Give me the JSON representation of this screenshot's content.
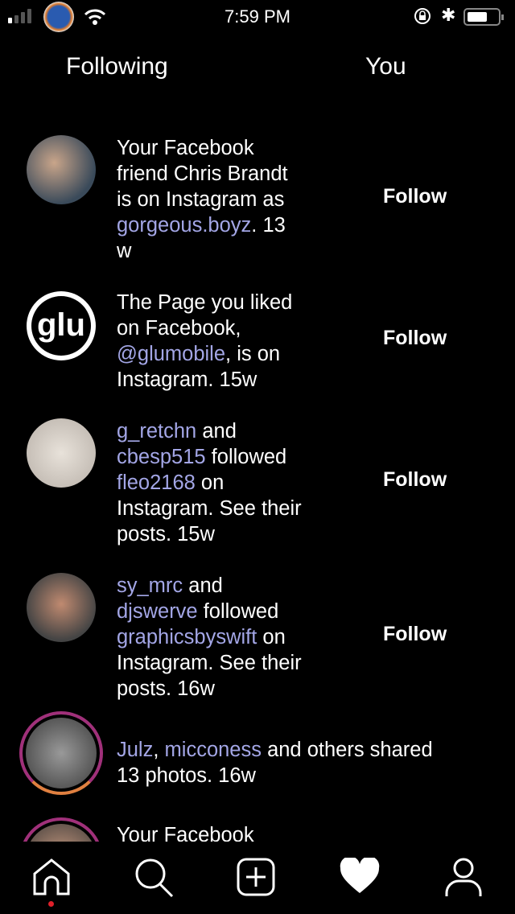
{
  "status_bar": {
    "time": "7:59 PM"
  },
  "tabs": [
    {
      "label": "Following"
    },
    {
      "label": "You"
    }
  ],
  "feed": [
    {
      "lines": [
        [
          {
            "t": "Your Facebook"
          }
        ],
        [
          {
            "t": "friend Chris Brandt"
          }
        ],
        [
          {
            "t": "is on Instagram as"
          }
        ],
        [
          {
            "t": "gorgeous.boyz",
            "link": true
          },
          {
            "t": ". 13"
          }
        ],
        [
          {
            "t": "w"
          }
        ]
      ],
      "follow": "Follow"
    },
    {
      "lines": [
        [
          {
            "t": "The Page you liked"
          }
        ],
        [
          {
            "t": "on Facebook,"
          }
        ],
        [
          {
            "t": "@glumobile",
            "link": true
          },
          {
            "t": ", is on"
          }
        ],
        [
          {
            "t": "Instagram. 15w"
          }
        ]
      ],
      "follow": "Follow",
      "avatar_text": "glu"
    },
    {
      "lines": [
        [
          {
            "t": "g_retchn",
            "link": true
          },
          {
            "t": " and"
          }
        ],
        [
          {
            "t": "cbesp515",
            "link": true
          },
          {
            "t": " followed"
          }
        ],
        [
          {
            "t": "fleo2168",
            "link": true
          },
          {
            "t": " on"
          }
        ],
        [
          {
            "t": "Instagram. See their"
          }
        ],
        [
          {
            "t": "posts. 15w"
          }
        ]
      ],
      "follow": "Follow"
    },
    {
      "lines": [
        [
          {
            "t": "sy_mrc",
            "link": true
          },
          {
            "t": " and"
          }
        ],
        [
          {
            "t": "djswerve",
            "link": true
          },
          {
            "t": " followed"
          }
        ],
        [
          {
            "t": "graphicsbyswift",
            "link": true
          },
          {
            "t": " on"
          }
        ],
        [
          {
            "t": "Instagram. See their"
          }
        ],
        [
          {
            "t": "posts. 16w"
          }
        ]
      ],
      "follow": "Follow"
    },
    {
      "lines": [
        [
          {
            "t": "Julz",
            "link": true
          },
          {
            "t": ", "
          },
          {
            "t": "micconess",
            "link": true
          },
          {
            "t": " and others shared"
          }
        ],
        [
          {
            "t": "13 photos. 16w"
          }
        ]
      ],
      "story_ring": true
    },
    {
      "lines": [
        [
          {
            "t": "Your Facebook"
          }
        ]
      ],
      "story_ring": true
    }
  ],
  "nav": [
    {
      "icon": "home-icon",
      "active": true
    },
    {
      "icon": "search-icon"
    },
    {
      "icon": "add-post-icon"
    },
    {
      "icon": "heart-icon"
    },
    {
      "icon": "profile-icon"
    }
  ],
  "colors": {
    "link": "#a3a6e6",
    "notification_dot": "#e0202a"
  }
}
